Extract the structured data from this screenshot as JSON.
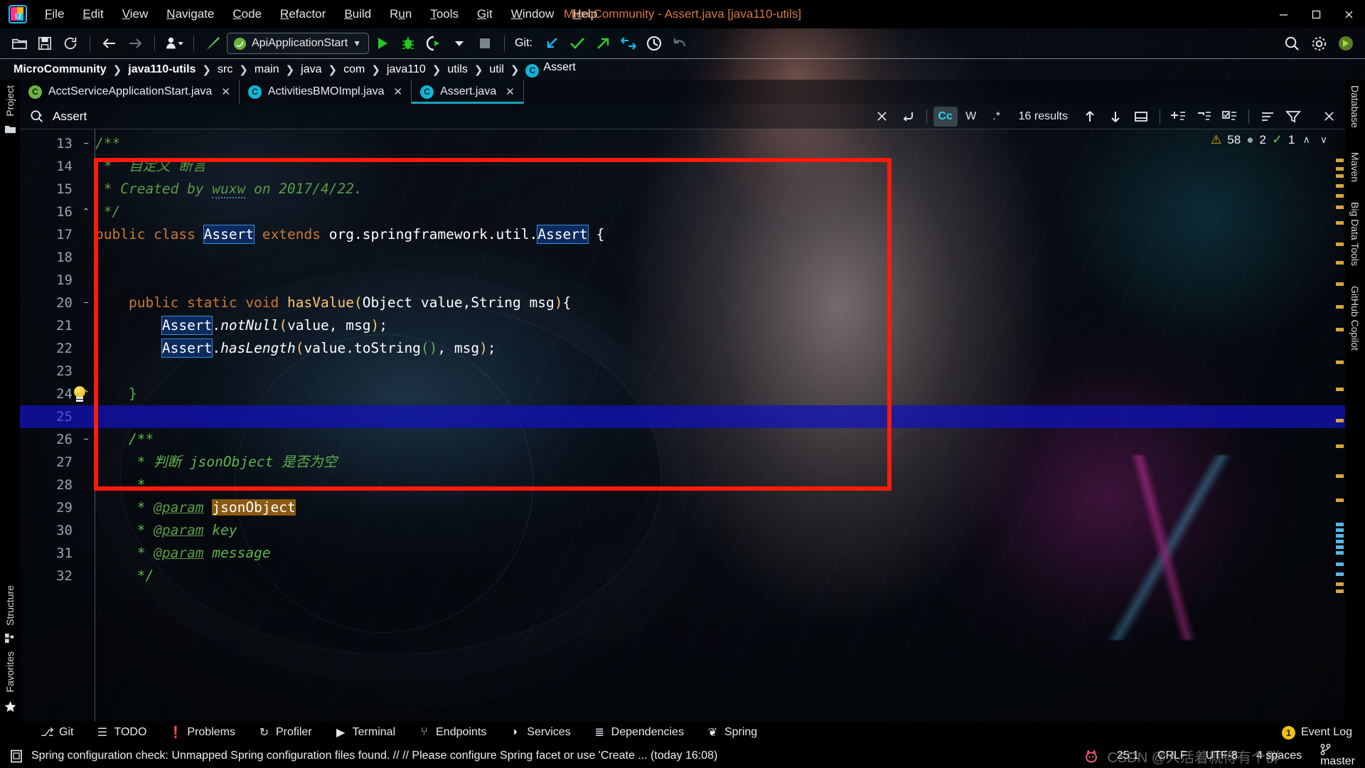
{
  "window": {
    "title": "MicroCommunity - Assert.java [java110-utils]",
    "controls": {
      "minimize": "—",
      "maximize": "❐",
      "close": "✕"
    }
  },
  "menubar": {
    "items": [
      {
        "label": "File",
        "mnemonic": "F"
      },
      {
        "label": "Edit",
        "mnemonic": "E"
      },
      {
        "label": "View",
        "mnemonic": "V"
      },
      {
        "label": "Navigate",
        "mnemonic": "N"
      },
      {
        "label": "Code",
        "mnemonic": "C"
      },
      {
        "label": "Refactor",
        "mnemonic": "R"
      },
      {
        "label": "Build",
        "mnemonic": "B"
      },
      {
        "label": "Run",
        "mnemonic": "u"
      },
      {
        "label": "Tools",
        "mnemonic": "T"
      },
      {
        "label": "Git",
        "mnemonic": "G"
      },
      {
        "label": "Window",
        "mnemonic": "W"
      },
      {
        "label": "Help",
        "mnemonic": "H"
      }
    ]
  },
  "toolbar": {
    "run_configuration": "ApiApplicationStart",
    "git_label": "Git:",
    "icons": [
      "open-folder-icon",
      "save-icon",
      "sync-icon",
      "back-arrow-icon",
      "forward-arrow-icon",
      "profile-dropdown-icon",
      "build-hammer-icon"
    ],
    "run_icons": [
      "run-icon",
      "debug-icon",
      "run-coverage-icon",
      "more-run-icon",
      "stop-icon"
    ],
    "git_icons": [
      "update-project-icon",
      "commit-icon",
      "push-icon",
      "rollback-icon",
      "history-icon",
      "undo-icon"
    ],
    "right_icons": [
      "search-everywhere-icon",
      "settings-gear-icon",
      "account-avatar-icon"
    ]
  },
  "breadcrumbs": {
    "separator": "❯",
    "items": [
      {
        "label": "MicroCommunity",
        "bold": true
      },
      {
        "label": "java110-utils",
        "bold": true
      },
      {
        "label": "src",
        "bold": false
      },
      {
        "label": "main",
        "bold": false
      },
      {
        "label": "java",
        "bold": false
      },
      {
        "label": "com",
        "bold": false
      },
      {
        "label": "java110",
        "bold": false
      },
      {
        "label": "utils",
        "bold": false
      },
      {
        "label": "util",
        "bold": false
      },
      {
        "label": "Assert",
        "bold": false,
        "icon": "C"
      }
    ]
  },
  "tool_strips": {
    "left": [
      "Project",
      "Structure",
      "Favorites"
    ],
    "right": [
      "Database",
      "Maven",
      "Big Data Tools",
      "GitHub Copilot"
    ]
  },
  "tabs": [
    {
      "label": "AcctServiceApplicationStart.java",
      "icon": "spring-class-icon",
      "active": false,
      "close": "✕"
    },
    {
      "label": "ActivitiesBMOImpl.java",
      "icon": "class-icon",
      "active": false,
      "close": "✕"
    },
    {
      "label": "Assert.java",
      "icon": "class-icon",
      "active": true,
      "close": "✕"
    }
  ],
  "findbar": {
    "query": "Assert",
    "placeholder": "Search",
    "results": "16 results",
    "buttons": [
      {
        "name": "close-find-icon",
        "glyph": "✕",
        "on": false
      },
      {
        "name": "regex-newline-icon",
        "glyph": "↲",
        "on": false
      },
      {
        "name": "match-case-toggle",
        "glyph": "Cc",
        "on": true
      },
      {
        "name": "words-toggle",
        "glyph": "W",
        "on": false
      },
      {
        "name": "regex-toggle",
        "glyph": ".*",
        "on": false
      },
      {
        "name": "prev-match-icon",
        "glyph": "↑",
        "on": false
      },
      {
        "name": "next-match-icon",
        "glyph": "↓",
        "on": false
      },
      {
        "name": "select-all-occurrences-icon",
        "glyph": "▭",
        "on": false
      },
      {
        "name": "add-selection-icon",
        "glyph": "⇱",
        "on": false
      },
      {
        "name": "exclude-icon",
        "glyph": "⌐",
        "on": false
      },
      {
        "name": "open-in-find-window-icon",
        "glyph": "☑",
        "on": false
      },
      {
        "name": "preserve-case-icon",
        "glyph": "≡",
        "on": false
      },
      {
        "name": "filter-icon",
        "glyph": "▽",
        "on": false
      }
    ]
  },
  "inspections": {
    "warnings": "58",
    "weak_warnings": "2",
    "ok_count": "1",
    "warning_icon": "warning-triangle-icon",
    "ok_icon": "check-icon",
    "up_icon": "∧",
    "down_icon": "∨"
  },
  "editor": {
    "current_line": 25,
    "first_line": 13,
    "lines": [
      {
        "n": 13,
        "fold": "−",
        "tokens": [
          {
            "t": "/**",
            "c": "cmt"
          }
        ]
      },
      {
        "n": 14,
        "fold": "",
        "tokens": [
          {
            "t": " *  自定义 断言",
            "c": "cmt"
          }
        ]
      },
      {
        "n": 15,
        "fold": "",
        "tokens": [
          {
            "t": " * Created by ",
            "c": "cmt"
          },
          {
            "t": "wuxw",
            "c": "cmt squig"
          },
          {
            "t": " on 2017/4/22.",
            "c": "cmt"
          }
        ]
      },
      {
        "n": 16,
        "fold": "⌃",
        "tokens": [
          {
            "t": " */",
            "c": "cmt"
          }
        ]
      },
      {
        "n": 17,
        "fold": "",
        "tokens": [
          {
            "t": "public class ",
            "c": "kw"
          },
          {
            "t": "Assert",
            "c": "hl"
          },
          {
            "t": " ",
            "c": "pun"
          },
          {
            "t": "extends",
            "c": "kw"
          },
          {
            "t": " org.springframework.util.",
            "c": "cls"
          },
          {
            "t": "Assert",
            "c": "hl"
          },
          {
            "t": " {",
            "c": "cls"
          }
        ]
      },
      {
        "n": 18,
        "fold": "",
        "tokens": []
      },
      {
        "n": 19,
        "fold": "",
        "tokens": []
      },
      {
        "n": 20,
        "fold": "−",
        "tokens": [
          {
            "t": "    public static void ",
            "c": "kw"
          },
          {
            "t": "hasValue",
            "c": "mth"
          },
          {
            "t": "(",
            "c": "brk"
          },
          {
            "t": "Object value,String msg",
            "c": "cls"
          },
          {
            "t": ")",
            "c": "brk"
          },
          {
            "t": "{",
            "c": "cls"
          }
        ]
      },
      {
        "n": 21,
        "fold": "",
        "tokens": [
          {
            "t": "        ",
            "c": "pun"
          },
          {
            "t": "Assert",
            "c": "hl"
          },
          {
            "t": ".",
            "c": "cls"
          },
          {
            "t": "notNull",
            "c": "mthi"
          },
          {
            "t": "(",
            "c": "brk"
          },
          {
            "t": "value, msg",
            "c": "cls"
          },
          {
            "t": ")",
            "c": "brk"
          },
          {
            "t": ";",
            "c": "cls"
          }
        ]
      },
      {
        "n": 22,
        "fold": "",
        "tokens": [
          {
            "t": "        ",
            "c": "pun"
          },
          {
            "t": "Assert",
            "c": "hl"
          },
          {
            "t": ".",
            "c": "cls"
          },
          {
            "t": "hasLength",
            "c": "mthi"
          },
          {
            "t": "(",
            "c": "brk"
          },
          {
            "t": "value.",
            "c": "cls"
          },
          {
            "t": "toString",
            "c": "cls"
          },
          {
            "t": "(",
            "c": "brk2"
          },
          {
            "t": ")",
            "c": "brk2"
          },
          {
            "t": ", msg",
            "c": "cls"
          },
          {
            "t": ")",
            "c": "brk"
          },
          {
            "t": ";",
            "c": "cls"
          }
        ]
      },
      {
        "n": 23,
        "fold": "",
        "tokens": []
      },
      {
        "n": 24,
        "fold": "⌃",
        "bulb": true,
        "tokens": [
          {
            "t": "    ",
            "c": "pun"
          },
          {
            "t": "}",
            "c": "brk2"
          }
        ]
      },
      {
        "n": 25,
        "fold": "",
        "current": true,
        "tokens": []
      },
      {
        "n": 26,
        "fold": "−",
        "tokens": [
          {
            "t": "    /**",
            "c": "cmt2"
          }
        ]
      },
      {
        "n": 27,
        "fold": "",
        "tokens": [
          {
            "t": "     * 判断 ",
            "c": "cmt2"
          },
          {
            "t": "jsonObject",
            "c": "cmt2"
          },
          {
            "t": " 是否为空",
            "c": "cmt2"
          }
        ]
      },
      {
        "n": 28,
        "fold": "",
        "tokens": [
          {
            "t": "     *",
            "c": "cmt2"
          }
        ]
      },
      {
        "n": 29,
        "fold": "",
        "tokens": [
          {
            "t": "     * ",
            "c": "cmt2"
          },
          {
            "t": "@param",
            "c": "tag"
          },
          {
            "t": " ",
            "c": "cmt2"
          },
          {
            "t": "jsonObject",
            "c": "hlw"
          }
        ]
      },
      {
        "n": 30,
        "fold": "",
        "tokens": [
          {
            "t": "     * ",
            "c": "cmt2"
          },
          {
            "t": "@param",
            "c": "tag"
          },
          {
            "t": " ",
            "c": "cmt2"
          },
          {
            "t": "key",
            "c": "cmt2"
          }
        ]
      },
      {
        "n": 31,
        "fold": "",
        "tokens": [
          {
            "t": "     * ",
            "c": "cmt2"
          },
          {
            "t": "@param",
            "c": "tag"
          },
          {
            "t": " ",
            "c": "cmt2"
          },
          {
            "t": "message",
            "c": "cmt2"
          }
        ]
      },
      {
        "n": 32,
        "fold": "",
        "tokens": [
          {
            "t": "     */",
            "c": "cmt2"
          }
        ]
      }
    ],
    "annotation_rect": {
      "label": "red-highlight-rectangle"
    }
  },
  "bottom_tools": [
    {
      "label": "Git",
      "icon": "git-branch-icon"
    },
    {
      "label": "TODO",
      "icon": "todo-list-icon"
    },
    {
      "label": "Problems",
      "icon": "problems-icon"
    },
    {
      "label": "Profiler",
      "icon": "profiler-icon"
    },
    {
      "label": "Terminal",
      "icon": "terminal-icon"
    },
    {
      "label": "Endpoints",
      "icon": "endpoints-icon"
    },
    {
      "label": "Services",
      "icon": "services-icon"
    },
    {
      "label": "Dependencies",
      "icon": "dependencies-icon"
    },
    {
      "label": "Spring",
      "icon": "spring-leaf-icon"
    }
  ],
  "event_log": {
    "label": "Event Log",
    "count": "1"
  },
  "statusbar": {
    "message": "Spring configuration check: Unmapped Spring configuration files found. // // Please configure Spring facet or use 'Create ... (today 16:08)",
    "message_icon": "notification-icon",
    "pig_icon": "pig-icon",
    "caret": "25:1",
    "line_separator": "CRLF",
    "encoding": "UTF-8",
    "indent": "4 spaces",
    "branch": "master",
    "branch_icon": "git-branch-icon"
  },
  "watermark": "CSDN @人活着就得有个群",
  "colors": {
    "title_accent": "#d9763c",
    "tab_underline": "#16a3b8",
    "caret_line": "#1012be",
    "annotation": "#ff1b0c",
    "match_highlight_bg": "#0b2a5e",
    "match_highlight_border": "#3b8ede",
    "word_highlight_bg": "#8a5a12",
    "keyword": "#cc7832",
    "comment": "#5a9c45",
    "method": "#ffc66d",
    "warning": "#f0b400",
    "ok": "#62c554"
  }
}
